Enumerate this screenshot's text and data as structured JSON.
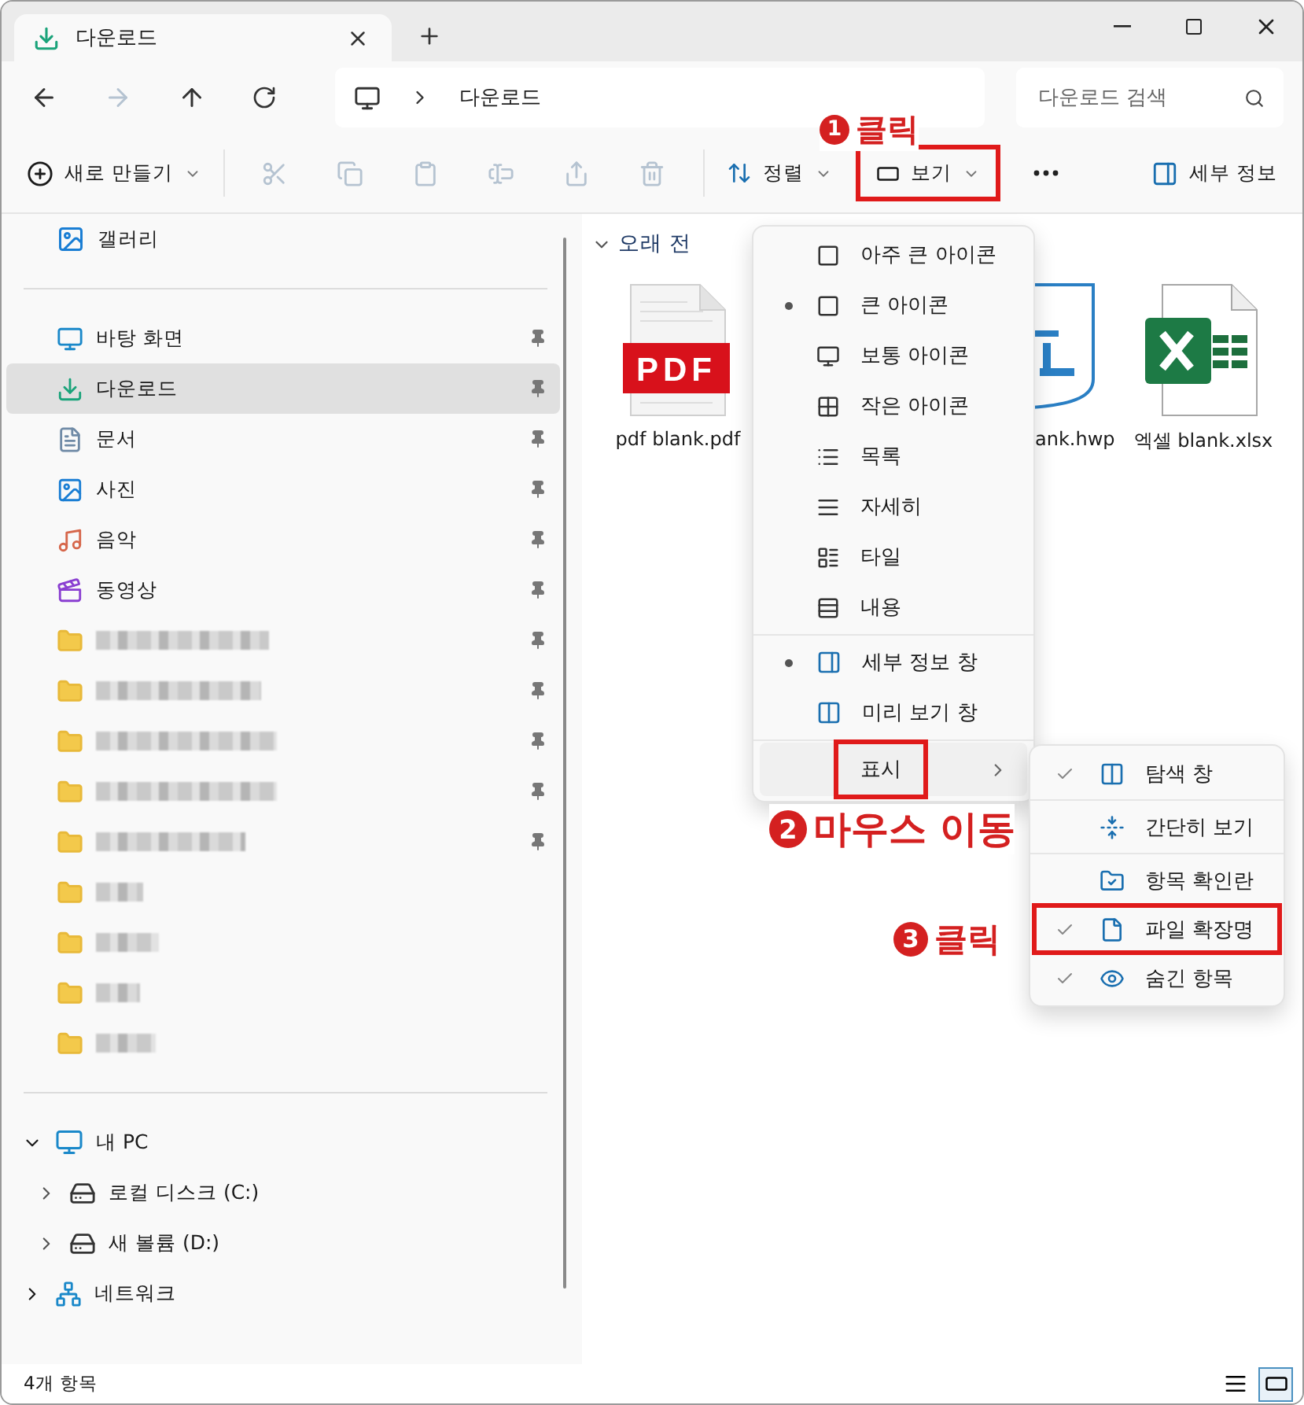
{
  "window": {
    "tab": {
      "title": "다운로드",
      "selected": true
    }
  },
  "address": {
    "path": "다운로드",
    "search": {
      "placeholder": "다운로드 검색"
    }
  },
  "toolbar": {
    "new": {
      "label": "새로 만들기"
    },
    "actions": [
      {
        "kind": "cut",
        "disabled": true
      },
      {
        "kind": "copy",
        "disabled": true
      },
      {
        "kind": "paste",
        "disabled": true
      },
      {
        "kind": "rename",
        "disabled": true
      },
      {
        "kind": "share",
        "disabled": true
      },
      {
        "kind": "delete",
        "disabled": true
      }
    ],
    "sort": {
      "label": "정렬"
    },
    "view": {
      "label": "보기",
      "highlighted": true
    },
    "details": {
      "label": "세부 정보"
    }
  },
  "sidebar": {
    "top": [
      {
        "label": "갤러리",
        "selected": false
      }
    ],
    "quick_access": [
      {
        "kind": "place",
        "label": "바탕 화면",
        "pinned": true,
        "selected": false
      },
      {
        "kind": "place",
        "label": "다운로드",
        "pinned": true,
        "selected": true
      },
      {
        "kind": "place",
        "label": "문서",
        "pinned": true,
        "selected": false
      },
      {
        "kind": "place",
        "label": "사진",
        "pinned": true,
        "selected": false
      },
      {
        "kind": "place",
        "label": "음악",
        "pinned": true,
        "selected": false
      },
      {
        "kind": "place",
        "label": "동영상",
        "pinned": true,
        "selected": false
      },
      {
        "kind": "redacted",
        "pinned": true,
        "selected": false
      },
      {
        "kind": "redacted",
        "pinned": true,
        "selected": false
      },
      {
        "kind": "redacted",
        "pinned": true,
        "selected": false
      },
      {
        "kind": "redacted",
        "pinned": true,
        "selected": false
      },
      {
        "kind": "redacted",
        "pinned": true,
        "selected": false
      },
      {
        "kind": "redacted",
        "pinned": false,
        "selected": false
      },
      {
        "kind": "redacted",
        "pinned": false,
        "selected": false
      },
      {
        "kind": "redacted",
        "pinned": false,
        "selected": false
      },
      {
        "kind": "redacted",
        "pinned": false,
        "selected": false
      }
    ],
    "tree": [
      {
        "label": "내 PC",
        "expanded": true,
        "children": [
          {
            "label": "로컬 디스크 (C:)",
            "expanded": false
          },
          {
            "label": "새 볼륨 (D:)",
            "expanded": false
          }
        ]
      },
      {
        "label": "네트워크",
        "expanded": false
      }
    ]
  },
  "content": {
    "group": {
      "label": "오래 전",
      "expanded": true
    },
    "files": [
      {
        "kind": "pdf",
        "name": "pdf blank.pdf",
        "badge": "PDF"
      },
      {
        "kind": "hwp",
        "name": "ank.hwp"
      },
      {
        "kind": "xlsx",
        "name": "엑셀 blank.xlsx"
      }
    ]
  },
  "view_menu": {
    "layouts": [
      {
        "label": "아주 큰 아이콘",
        "selected": false
      },
      {
        "label": "큰 아이콘",
        "selected": true
      },
      {
        "label": "보통 아이콘",
        "selected": false
      },
      {
        "label": "작은 아이콘",
        "selected": false
      },
      {
        "label": "목록",
        "selected": false
      },
      {
        "label": "자세히",
        "selected": false
      },
      {
        "label": "타일",
        "selected": false
      },
      {
        "label": "내용",
        "selected": false
      }
    ],
    "panes": [
      {
        "label": "세부 정보 창",
        "selected": true
      },
      {
        "label": "미리 보기 창",
        "selected": false
      }
    ],
    "show": {
      "label": "표시",
      "highlighted": true
    }
  },
  "show_menu": [
    {
      "label": "탐색 창",
      "checked": true,
      "highlighted": false
    },
    {
      "label": "간단히 보기",
      "checked": false,
      "highlighted": false
    },
    {
      "label": "항목 확인란",
      "checked": false,
      "highlighted": false
    },
    {
      "label": "파일 확장명",
      "checked": true,
      "highlighted": true
    },
    {
      "label": "숨긴 항목",
      "checked": true,
      "highlighted": false
    }
  ],
  "annotations": [
    {
      "number": "1",
      "label": "클릭"
    },
    {
      "number": "2",
      "label": "마우스 이동"
    },
    {
      "number": "3",
      "label": "클릭"
    }
  ],
  "status_bar": {
    "count": "4개 항목",
    "views": [
      {
        "kind": "details",
        "selected": false
      },
      {
        "kind": "large-icons",
        "selected": true
      }
    ]
  }
}
